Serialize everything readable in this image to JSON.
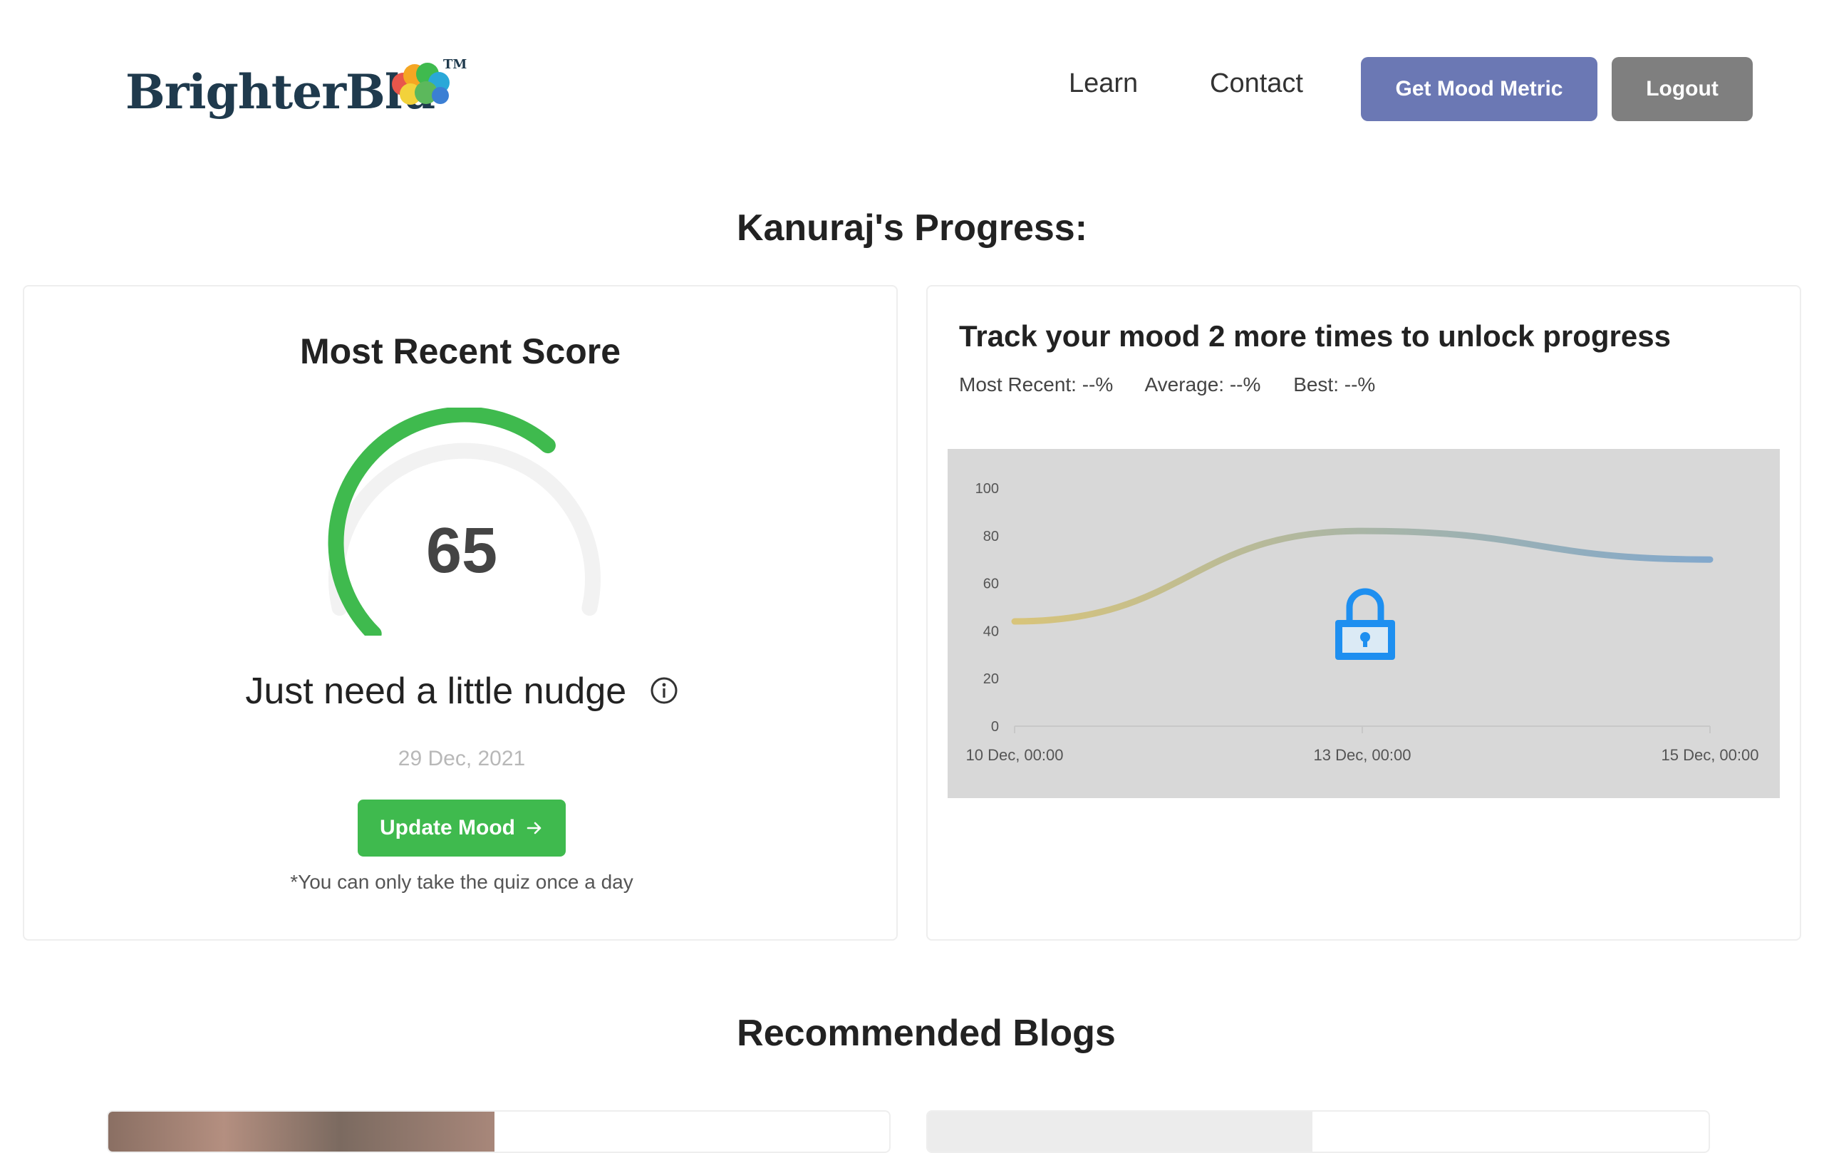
{
  "brand": {
    "name": "BrighterBlu",
    "tm": "TM"
  },
  "nav": {
    "learn": "Learn",
    "contact": "Contact",
    "get_mood_metric": "Get Mood Metric",
    "logout": "Logout"
  },
  "page_title": "Kanuraj's Progress:",
  "recent_score": {
    "title": "Most Recent Score",
    "value": "65",
    "gauge_fraction": 0.65,
    "message": "Just need a little nudge",
    "date": "29 Dec, 2021",
    "update_button": "Update Mood",
    "note": "*You can only take the quiz once a day"
  },
  "progress": {
    "title": "Track your mood 2 more times to unlock progress",
    "most_recent": "Most Recent: --%",
    "average": "Average: --%",
    "best": "Best: --%"
  },
  "chart_data": {
    "type": "line",
    "x": [
      "10 Dec, 00:00",
      "13 Dec, 00:00",
      "15 Dec, 00:00"
    ],
    "y_ticks": [
      0,
      20,
      40,
      60,
      80,
      100
    ],
    "ylim": [
      0,
      100
    ],
    "series": [
      {
        "values": [
          44,
          82,
          70
        ]
      }
    ],
    "locked": true
  },
  "colors": {
    "accent_purple": "#6b78b4",
    "logout_gray": "#7f7f7f",
    "success_green": "#3fba4e",
    "lock_blue": "#1e8ff0"
  },
  "blogs": {
    "title": "Recommended Blogs"
  }
}
